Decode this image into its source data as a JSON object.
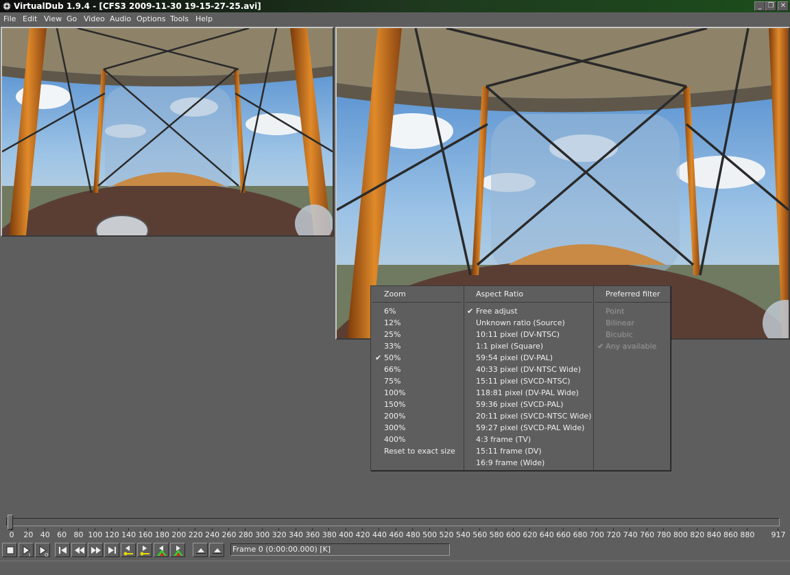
{
  "window": {
    "title": "VirtualDub 1.9.4 - [CFS3 2009-11-30 19-15-27-25.avi]",
    "controls": [
      "_",
      "❐",
      "✕"
    ]
  },
  "menubar": {
    "items": [
      "File",
      "Edit",
      "View",
      "Go",
      "Video",
      "Audio",
      "Options",
      "Tools",
      "Help"
    ]
  },
  "panes": {
    "input_label": "input-video",
    "output_label": "output-video"
  },
  "popup": {
    "zoom": {
      "header": "Zoom",
      "items": [
        "6%",
        "12%",
        "25%",
        "33%",
        "50%",
        "66%",
        "75%",
        "100%",
        "150%",
        "200%",
        "300%",
        "400%",
        "Reset to exact size"
      ],
      "checked_index": 4
    },
    "aspect": {
      "header": "Aspect Ratio",
      "items": [
        "Free adjust",
        "Unknown ratio (Source)",
        "10:11 pixel (DV-NTSC)",
        "1:1 pixel (Square)",
        "59:54 pixel (DV-PAL)",
        "40:33 pixel (DV-NTSC Wide)",
        "15:11 pixel (SVCD-NTSC)",
        "118:81 pixel (DV-PAL Wide)",
        "59:36 pixel (SVCD-PAL)",
        "20:11 pixel (SVCD-NTSC Wide)",
        "59:27 pixel (SVCD-PAL Wide)",
        "4:3 frame (TV)",
        "15:11 frame (DV)",
        "16:9 frame (Wide)"
      ],
      "checked_index": 0
    },
    "filter": {
      "header": "Preferred filter",
      "items": [
        "Point",
        "Bilinear",
        "Bicubic",
        "Any available"
      ],
      "checked_index": 3,
      "disabled": true
    },
    "check_glyph": "✔"
  },
  "timeline": {
    "labels": [
      "0",
      "20",
      "40",
      "60",
      "80",
      "100",
      "120",
      "140",
      "160",
      "180",
      "200",
      "220",
      "240",
      "260",
      "280",
      "300",
      "320",
      "340",
      "360",
      "380",
      "400",
      "420",
      "440",
      "460",
      "480",
      "500",
      "520",
      "540",
      "560",
      "580",
      "600",
      "620",
      "640",
      "660",
      "680",
      "700",
      "720",
      "740",
      "760",
      "780",
      "800",
      "820",
      "840",
      "860",
      "880",
      "917"
    ],
    "position": 0,
    "total": 917
  },
  "toolbar": {
    "buttons": [
      "stop-button",
      "play-input-button",
      "play-output-button",
      "start-button",
      "prev-frame-button",
      "next-frame-button",
      "end-button",
      "prev-keyframe-button",
      "next-keyframe-button",
      "prev-scene-button",
      "next-scene-button",
      "mark-in-button",
      "mark-out-button"
    ],
    "status": "Frame 0 (0:00:00.000) [K]"
  },
  "colors": {
    "background": "#5e5e5e",
    "titlebar_start": "#0e0e0e",
    "titlebar_end": "#1c4d1c",
    "key_yellow": "#e8d800",
    "scene_green": "#2fd02f",
    "scene_red": "#e02020"
  }
}
